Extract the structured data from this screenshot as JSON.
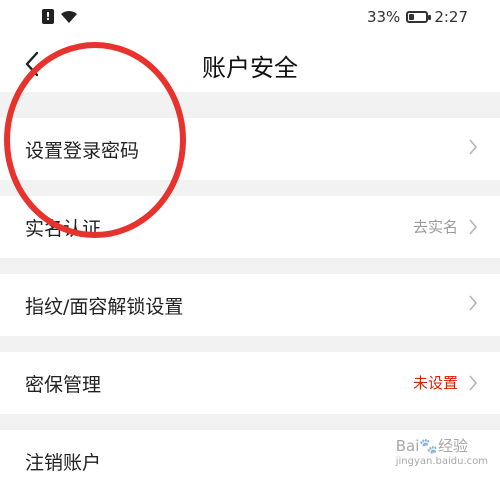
{
  "status_bar": {
    "battery_percent_text": "33%",
    "battery_level": 0.33,
    "time": "2:27"
  },
  "nav": {
    "title": "账户安全"
  },
  "rows": [
    {
      "label": "设置登录密码",
      "value": ""
    },
    {
      "label": "实名认证",
      "value": "去实名"
    },
    {
      "label": "指纹/面容解锁设置",
      "value": ""
    },
    {
      "label": "密保管理",
      "value": "未设置"
    },
    {
      "label": "注销账户",
      "value": ""
    }
  ],
  "watermark": {
    "brand": "Bai🐾经验",
    "site": "jingyan.baidu.com"
  },
  "colors": {
    "warning": "#d81e06",
    "annotation_circle": "#e8322d"
  }
}
